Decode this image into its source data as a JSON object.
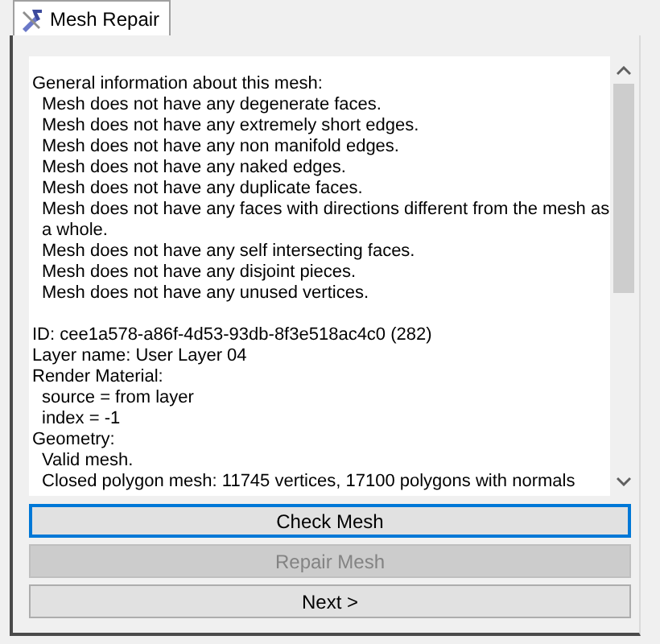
{
  "tab": {
    "label": "Mesh Repair",
    "selected": true
  },
  "report": {
    "blocks": [
      [
        {
          "text": "General information about this mesh:",
          "children": [
            {
              "text": "Mesh does not have any degenerate faces."
            },
            {
              "text": "Mesh does not have any extremely short edges."
            },
            {
              "text": "Mesh does not have any non manifold edges."
            },
            {
              "text": "Mesh does not have any naked edges."
            },
            {
              "text": "Mesh does not have any duplicate faces."
            },
            {
              "text": "Mesh does not have any faces with directions different from the mesh as a whole."
            },
            {
              "text": "Mesh does not have any self intersecting faces."
            },
            {
              "text": "Mesh does not have any disjoint pieces."
            },
            {
              "text": "Mesh does not have any unused vertices."
            }
          ]
        }
      ],
      [
        {
          "text": "ID: cee1a578-a86f-4d53-93db-8f3e518ac4c0 (282)"
        },
        {
          "text": "Layer name: User Layer 04"
        },
        {
          "text": "Render Material:",
          "children": [
            {
              "text": "source = from layer"
            },
            {
              "text": "index = -1"
            }
          ]
        },
        {
          "text": "Geometry:",
          "children": [
            {
              "text": "Valid mesh."
            },
            {
              "text": "Closed polygon mesh: 11745 vertices, 17100 polygons with normals"
            }
          ]
        }
      ]
    ]
  },
  "buttons": [
    {
      "label": "Check Mesh",
      "focused": true,
      "disabled": false
    },
    {
      "label": "Repair Mesh",
      "focused": false,
      "disabled": true
    },
    {
      "label": "Next >",
      "focused": false,
      "disabled": false
    }
  ]
}
